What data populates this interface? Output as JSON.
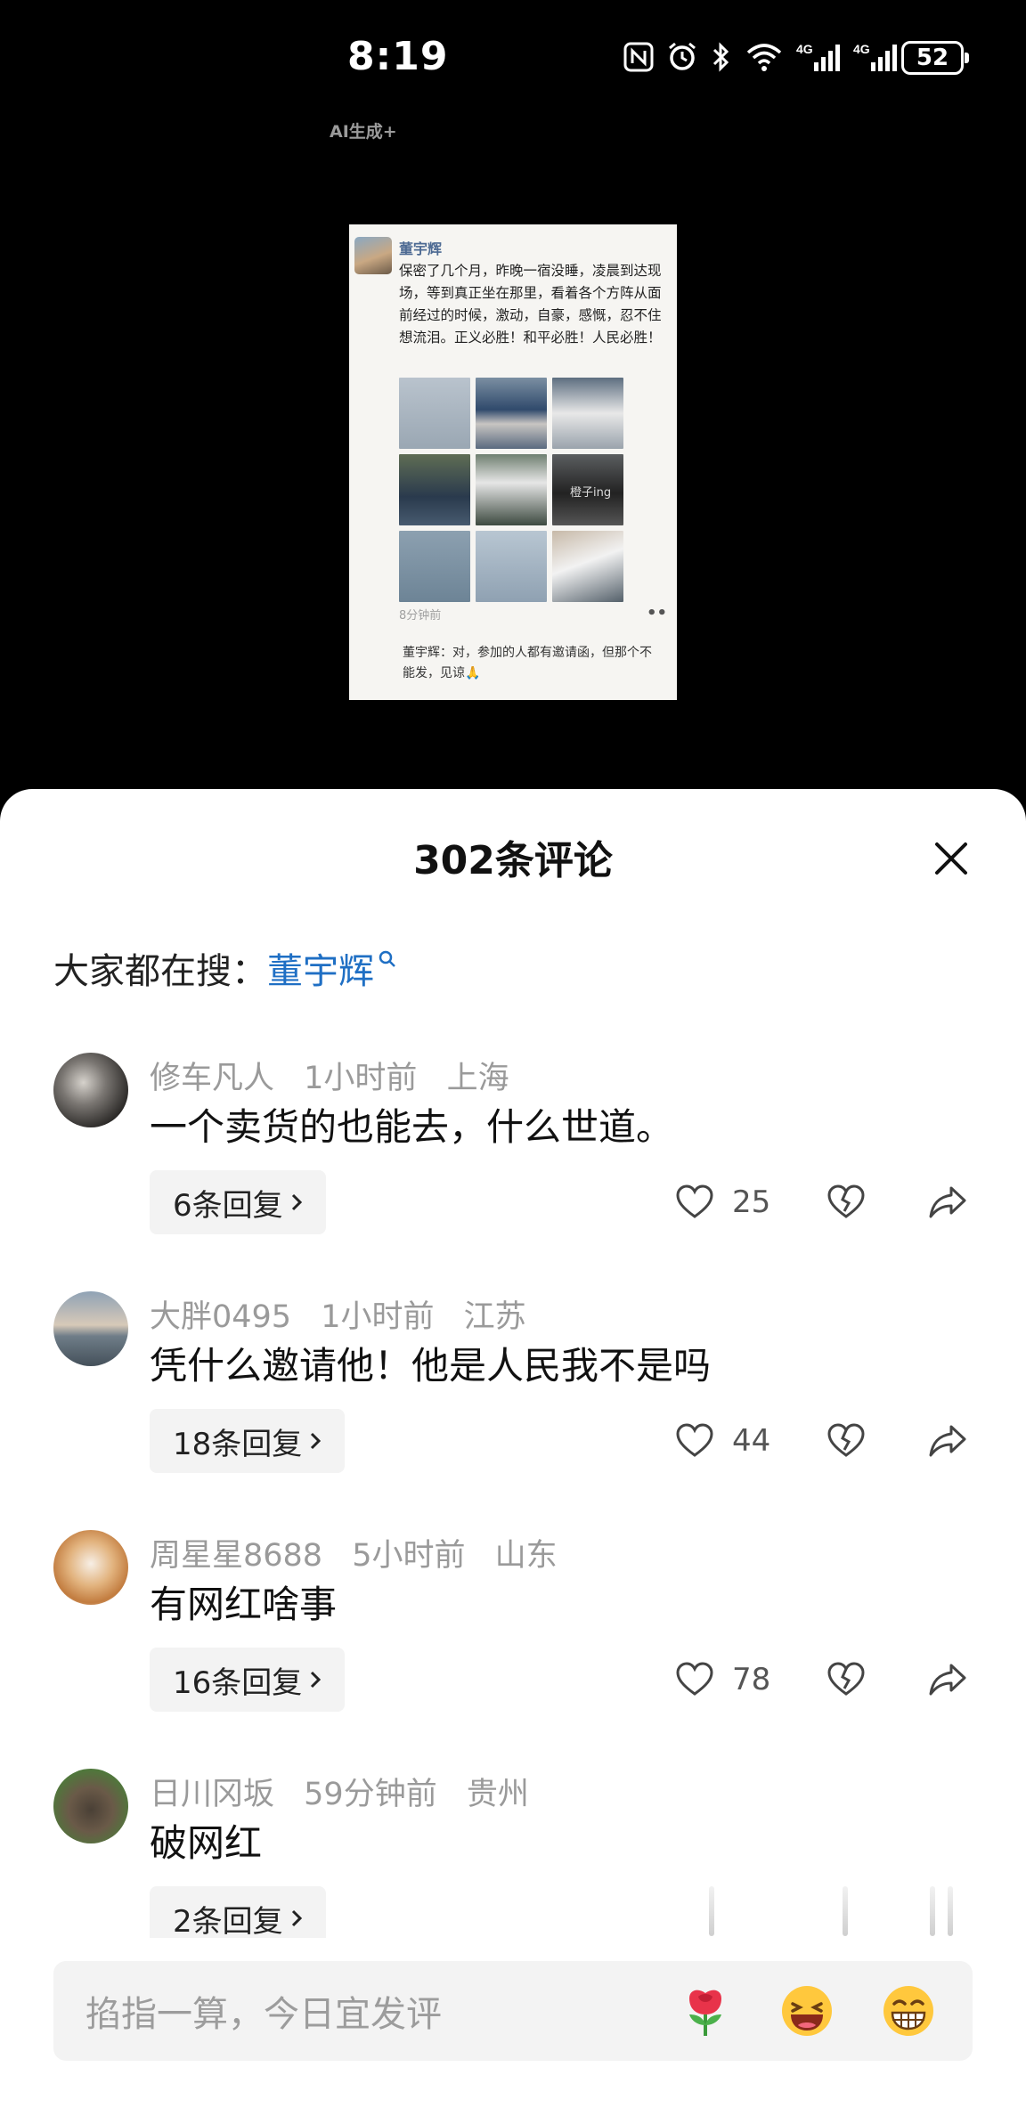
{
  "status_bar": {
    "time": "8:19",
    "battery": "52",
    "network_1": "4G",
    "network_2": "4G"
  },
  "video": {
    "ai_tag": "AI生成+",
    "post": {
      "author": "董宇辉",
      "text": "保密了几个月，昨晚一宿没睡，凌晨到达现场，等到真正坐在那里，看着各个方阵从面前经过的时候，激动，自豪，感慨，忍不住想流泪。正义必胜！和平必胜！人民必胜！",
      "image_watermark": "橙子ing",
      "time": "8分钟前",
      "reply": "董宇辉：对，参加的人都有邀请函，但那个不能发，见谅🙏"
    }
  },
  "sheet": {
    "title": "302条评论",
    "search_prefix": "大家都在搜：",
    "search_term": "董宇辉"
  },
  "comments": [
    {
      "user": "修车凡人",
      "time": "1小时前",
      "location": "上海",
      "text": "一个卖货的也能去，什么世道。",
      "replies": "6条回复",
      "likes": "25"
    },
    {
      "user": "大胖0495",
      "time": "1小时前",
      "location": "江苏",
      "text": "凭什么邀请他！他是人民我不是吗",
      "replies": "18条回复",
      "likes": "44"
    },
    {
      "user": "周星星8688",
      "time": "5小时前",
      "location": "山东",
      "text": "有网红啥事",
      "replies": "16条回复",
      "likes": "78"
    },
    {
      "user": "日川冈坂",
      "time": "59分钟前",
      "location": "贵州",
      "text": "破网红",
      "replies": "2条回复",
      "likes": ""
    }
  ],
  "input": {
    "placeholder": "掐指一算，今日宜发评"
  },
  "icons": {
    "like": "heart-icon",
    "dislike": "broken-heart-icon",
    "share": "share-arrow-icon",
    "emoji_1": "rose-emoji-icon",
    "emoji_2": "laughing-emoji-icon",
    "emoji_3": "grinning-emoji-icon"
  },
  "colors": {
    "search_term": "#1f6fc4",
    "meta_text": "#9a9a9a"
  }
}
